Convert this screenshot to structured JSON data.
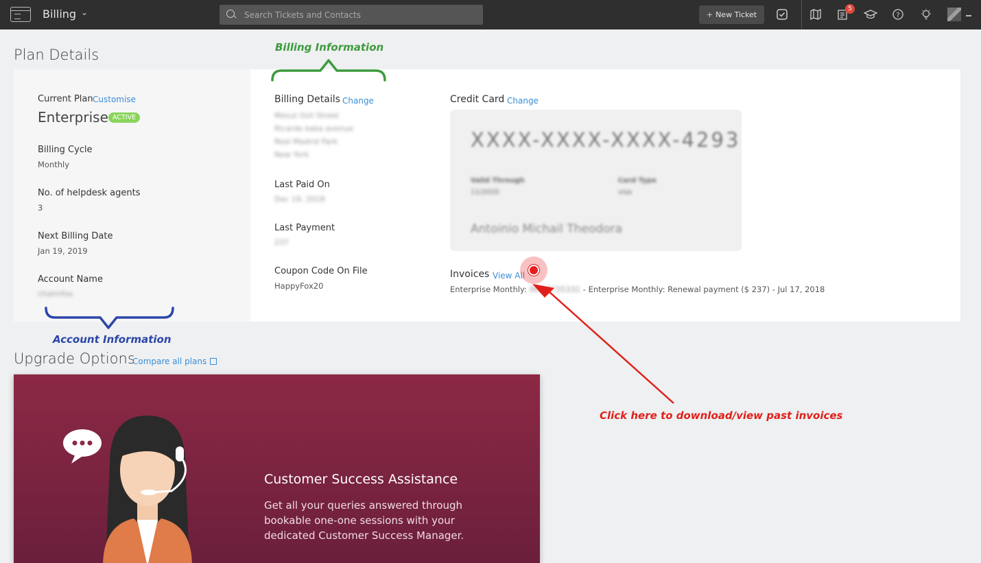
{
  "header": {
    "module_title": "Billing",
    "search_placeholder": "Search Tickets and Contacts",
    "new_ticket_label": "New Ticket",
    "notification_count": "5"
  },
  "plan_details": {
    "heading": "Plan Details",
    "current_plan_label": "Current Plan",
    "customise_link": "Customise",
    "plan_name": "Enterprise",
    "plan_status": "ACTIVE",
    "billing_cycle_label": "Billing Cycle",
    "billing_cycle_value": "Monthly",
    "agents_label": "No. of helpdesk agents",
    "agents_value": "3",
    "next_billing_label": "Next Billing Date",
    "next_billing_value": "Jan 19, 2019",
    "account_name_label": "Account Name",
    "account_name_value": "chatmfox"
  },
  "billing": {
    "details_label": "Billing Details",
    "change_link": "Change",
    "address_lines": [
      "Mesut Ozil Street",
      "Ricardo kaka avenue",
      "Real Madrid Park",
      "New York"
    ],
    "last_paid_label": "Last Paid On",
    "last_paid_value": "Dec 19, 2018",
    "last_payment_label": "Last Payment",
    "last_payment_value": "237",
    "coupon_label": "Coupon Code On File",
    "coupon_value": "HappyFox20"
  },
  "credit_card": {
    "label": "Credit Card",
    "change_link": "Change",
    "number": "XXXX-XXXX-XXXX-4293",
    "valid_through_label": "Valid Through",
    "valid_through_value": "11/2020",
    "card_type_label": "Card Type",
    "card_type_value": "visa",
    "holder_name": "Antoinio Michail Theodora"
  },
  "invoices": {
    "label": "Invoices",
    "view_all_link": "View All",
    "item_prefix": "Enterprise Monthly:",
    "item_blurred": "INV-7735331",
    "item_text": "- Enterprise Monthly: Renewal payment ($ 237) - Jul 17, 2018"
  },
  "upgrade": {
    "heading": "Upgrade Options",
    "compare_link": "Compare all plans",
    "banner_title": "Customer Success Assistance",
    "banner_desc": "Get all your queries answered through bookable one-one sessions with your dedicated Customer Success Manager."
  },
  "annotations": {
    "billing_information": "Billing Information",
    "account_information": "Account Information",
    "invoice_hint": "Click here to download/view past invoices"
  },
  "colors": {
    "topbar": "#2f2f2f",
    "link": "#3a8ed6",
    "active_badge": "#8bd45b",
    "banner": "#8c2945",
    "annotation_green": "#3e9b3e",
    "annotation_blue": "#2b45a8",
    "annotation_red": "#e0201a"
  }
}
